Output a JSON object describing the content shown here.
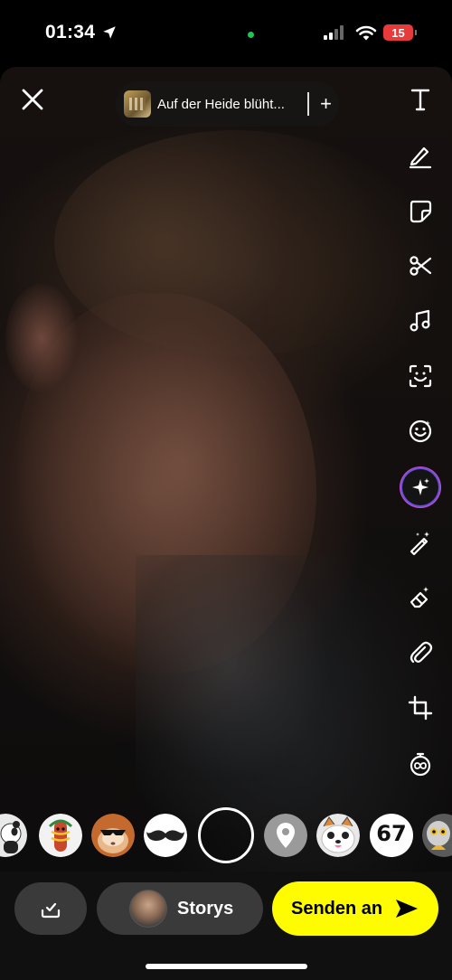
{
  "status_bar": {
    "time": "01:34",
    "battery": "15",
    "battery_color": "#e83a3a",
    "camera_indicator_color": "#23c552"
  },
  "top": {
    "close_icon": "close-icon",
    "sound": {
      "title": "Auf der Heide blüht...",
      "add_label": "+"
    }
  },
  "toolbar": [
    {
      "name": "text-tool",
      "icon": "text-icon"
    },
    {
      "name": "draw-tool",
      "icon": "pencil-icon"
    },
    {
      "name": "sticker-tool",
      "icon": "sticker-icon"
    },
    {
      "name": "scissors-tool",
      "icon": "scissors-icon"
    },
    {
      "name": "music-tool",
      "icon": "music-note-icon"
    },
    {
      "name": "lens-scan-tool",
      "icon": "scan-face-icon"
    },
    {
      "name": "emoji-tool",
      "icon": "smiley-icon"
    },
    {
      "name": "ai-tool",
      "icon": "sparkle-icon"
    },
    {
      "name": "magic-wand-tool",
      "icon": "magic-wand-icon"
    },
    {
      "name": "eraser-tool",
      "icon": "eraser-icon"
    },
    {
      "name": "attachment-tool",
      "icon": "paperclip-icon"
    },
    {
      "name": "crop-tool",
      "icon": "crop-icon"
    },
    {
      "name": "timer-tool",
      "icon": "timer-icon"
    }
  ],
  "lenses": [
    {
      "name": "panda-lens",
      "icon": "panda-icon"
    },
    {
      "name": "hotdog-lens",
      "icon": "hotdog-icon"
    },
    {
      "name": "hamster-sunglasses-lens",
      "icon": "hamster-icon"
    },
    {
      "name": "mustache-lens",
      "icon": "mustache-icon"
    },
    {
      "name": "location-lens",
      "icon": "location-pin-icon"
    },
    {
      "name": "cat-lens",
      "icon": "cat-face-icon"
    },
    {
      "name": "sixty-seven-lens",
      "text": "67"
    },
    {
      "name": "lemur-lens",
      "icon": "lemur-icon"
    }
  ],
  "bottom": {
    "save_icon": "save-check-icon",
    "story_label": "Storys",
    "send_label": "Senden an",
    "send_icon": "send-arrow-icon",
    "send_color": "#fffc00"
  }
}
